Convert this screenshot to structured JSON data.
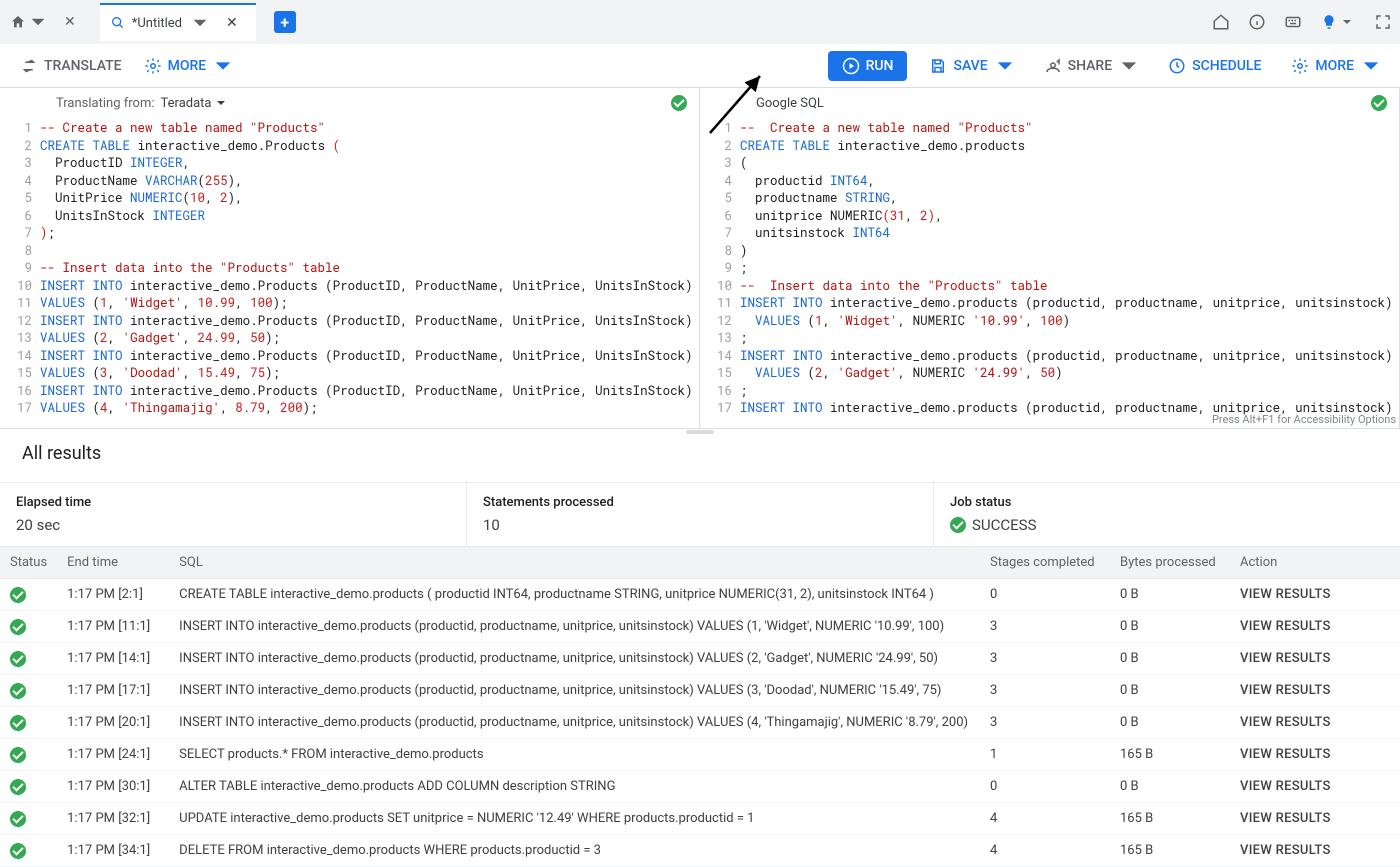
{
  "tab": {
    "title": "*Untitled"
  },
  "toolbar": {
    "translate": "TRANSLATE",
    "more_left": "MORE",
    "run": "RUN",
    "save": "SAVE",
    "share": "SHARE",
    "schedule": "SCHEDULE",
    "more_right": "MORE"
  },
  "left_pane": {
    "translating_from_label": "Translating from:",
    "source": "Teradata"
  },
  "right_pane": {
    "lang": "Google SQL"
  },
  "left_code": [
    {
      "comment": "-- Create a new table named \"Products\""
    },
    {
      "raw": "<span class='kw'>CREATE</span> <span class='kw'>TABLE</span> interactive_demo.Products <span class='paren-a'>(</span>"
    },
    {
      "raw": "  ProductID <span class='kw'>INTEGER</span>,"
    },
    {
      "raw": "  ProductName <span class='kw'>VARCHAR</span>(<span class='num'>255</span>),"
    },
    {
      "raw": "  UnitPrice <span class='kw'>NUMERIC</span>(<span class='num'>10</span>, <span class='num'>2</span>),"
    },
    {
      "raw": "  UnitsInStock <span class='kw'>INTEGER</span>"
    },
    {
      "raw": "<span class='paren-a'>)</span>;"
    },
    {
      "raw": ""
    },
    {
      "comment": "-- Insert data into the \"Products\" table"
    },
    {
      "raw": "<span class='kw'>INSERT</span> <span class='kw'>INTO</span> interactive_demo.Products (ProductID, ProductName, UnitPrice, UnitsInStock)"
    },
    {
      "raw": "<span class='kw'>VALUES</span> (<span class='num'>1</span>, <span class='str'>'Widget'</span>, <span class='num'>10.99</span>, <span class='num'>100</span>);"
    },
    {
      "raw": "<span class='kw'>INSERT</span> <span class='kw'>INTO</span> interactive_demo.Products (ProductID, ProductName, UnitPrice, UnitsInStock)"
    },
    {
      "raw": "<span class='kw'>VALUES</span> (<span class='num'>2</span>, <span class='str'>'Gadget'</span>, <span class='num'>24.99</span>, <span class='num'>50</span>);"
    },
    {
      "raw": "<span class='kw'>INSERT</span> <span class='kw'>INTO</span> interactive_demo.Products (ProductID, ProductName, UnitPrice, UnitsInStock)"
    },
    {
      "raw": "<span class='kw'>VALUES</span> (<span class='num'>3</span>, <span class='str'>'Doodad'</span>, <span class='num'>15.49</span>, <span class='num'>75</span>);"
    },
    {
      "raw": "<span class='kw'>INSERT</span> <span class='kw'>INTO</span> interactive_demo.Products (ProductID, ProductName, UnitPrice, UnitsInStock)"
    },
    {
      "raw": "<span class='kw'>VALUES</span> (<span class='num'>4</span>, <span class='str'>'Thingamajig'</span>, <span class='num'>8.79</span>, <span class='num'>200</span>);"
    }
  ],
  "right_code": [
    {
      "comment": "--  Create a new table named \"Products\""
    },
    {
      "raw": "<span class='kw'>CREATE</span> <span class='kw'>TABLE</span> interactive_demo.products"
    },
    {
      "raw": "("
    },
    {
      "raw": "  productid <span class='kw'>INT64</span>,"
    },
    {
      "raw": "  productname <span class='kw'>STRING</span>,"
    },
    {
      "raw": "  unitprice NUMERIC<span class='paren-a'>(</span><span class='num'>31</span>, <span class='num'>2</span><span class='paren-a'>)</span>,"
    },
    {
      "raw": "  unitsinstock <span class='kw'>INT64</span>"
    },
    {
      "raw": ")"
    },
    {
      "raw": ";"
    },
    {
      "comment": "--  Insert data into the \"Products\" table"
    },
    {
      "raw": "<span class='kw'>INSERT</span> <span class='kw'>INTO</span> interactive_demo.products (productid, productname, unitprice, unitsinstock)"
    },
    {
      "raw": "  <span class='kw'>VALUES</span> (<span class='num'>1</span>, <span class='str'>'Widget'</span>, NUMERIC <span class='str'>'10.99'</span>, <span class='num'>100</span>)"
    },
    {
      "raw": ";"
    },
    {
      "raw": "<span class='kw'>INSERT</span> <span class='kw'>INTO</span> interactive_demo.products (productid, productname, unitprice, unitsinstock)"
    },
    {
      "raw": "  <span class='kw'>VALUES</span> (<span class='num'>2</span>, <span class='str'>'Gadget'</span>, NUMERIC <span class='str'>'24.99'</span>, <span class='num'>50</span>)"
    },
    {
      "raw": ";"
    },
    {
      "raw": "<span class='kw'>INSERT</span> <span class='kw'>INTO</span> interactive_demo.products (productid, productname, unitprice, unitsinstock)"
    }
  ],
  "a11y_hint": "Press Alt+F1 for Accessibility Options",
  "results": {
    "title": "All results",
    "elapsed_label": "Elapsed time",
    "elapsed_value": "20 sec",
    "stmts_label": "Statements processed",
    "stmts_value": "10",
    "job_label": "Job status",
    "job_value": "SUCCESS",
    "columns": {
      "status": "Status",
      "end": "End time",
      "sql": "SQL",
      "stages": "Stages completed",
      "bytes": "Bytes processed",
      "action": "Action"
    },
    "action_label": "VIEW RESULTS",
    "rows": [
      {
        "end": "1:17 PM [2:1]",
        "sql": "CREATE TABLE interactive_demo.products ( productid INT64, productname STRING, unitprice NUMERIC(31, 2), unitsinstock INT64 )",
        "stages": "0",
        "bytes": "0 B"
      },
      {
        "end": "1:17 PM [11:1]",
        "sql": "INSERT INTO interactive_demo.products (productid, productname, unitprice, unitsinstock) VALUES (1, 'Widget', NUMERIC '10.99', 100)",
        "stages": "3",
        "bytes": "0 B"
      },
      {
        "end": "1:17 PM [14:1]",
        "sql": "INSERT INTO interactive_demo.products (productid, productname, unitprice, unitsinstock) VALUES (2, 'Gadget', NUMERIC '24.99', 50)",
        "stages": "3",
        "bytes": "0 B"
      },
      {
        "end": "1:17 PM [17:1]",
        "sql": "INSERT INTO interactive_demo.products (productid, productname, unitprice, unitsinstock) VALUES (3, 'Doodad', NUMERIC '15.49', 75)",
        "stages": "3",
        "bytes": "0 B"
      },
      {
        "end": "1:17 PM [20:1]",
        "sql": "INSERT INTO interactive_demo.products (productid, productname, unitprice, unitsinstock) VALUES (4, 'Thingamajig', NUMERIC '8.79', 200)",
        "stages": "3",
        "bytes": "0 B"
      },
      {
        "end": "1:17 PM [24:1]",
        "sql": "SELECT products.* FROM interactive_demo.products",
        "stages": "1",
        "bytes": "165 B"
      },
      {
        "end": "1:17 PM [30:1]",
        "sql": "ALTER TABLE interactive_demo.products ADD COLUMN description STRING",
        "stages": "0",
        "bytes": "0 B"
      },
      {
        "end": "1:17 PM [32:1]",
        "sql": "UPDATE interactive_demo.products SET unitprice = NUMERIC '12.49' WHERE products.productid = 1",
        "stages": "4",
        "bytes": "165 B"
      },
      {
        "end": "1:17 PM [34:1]",
        "sql": "DELETE FROM interactive_demo.products WHERE products.productid = 3",
        "stages": "4",
        "bytes": "165 B"
      }
    ]
  }
}
